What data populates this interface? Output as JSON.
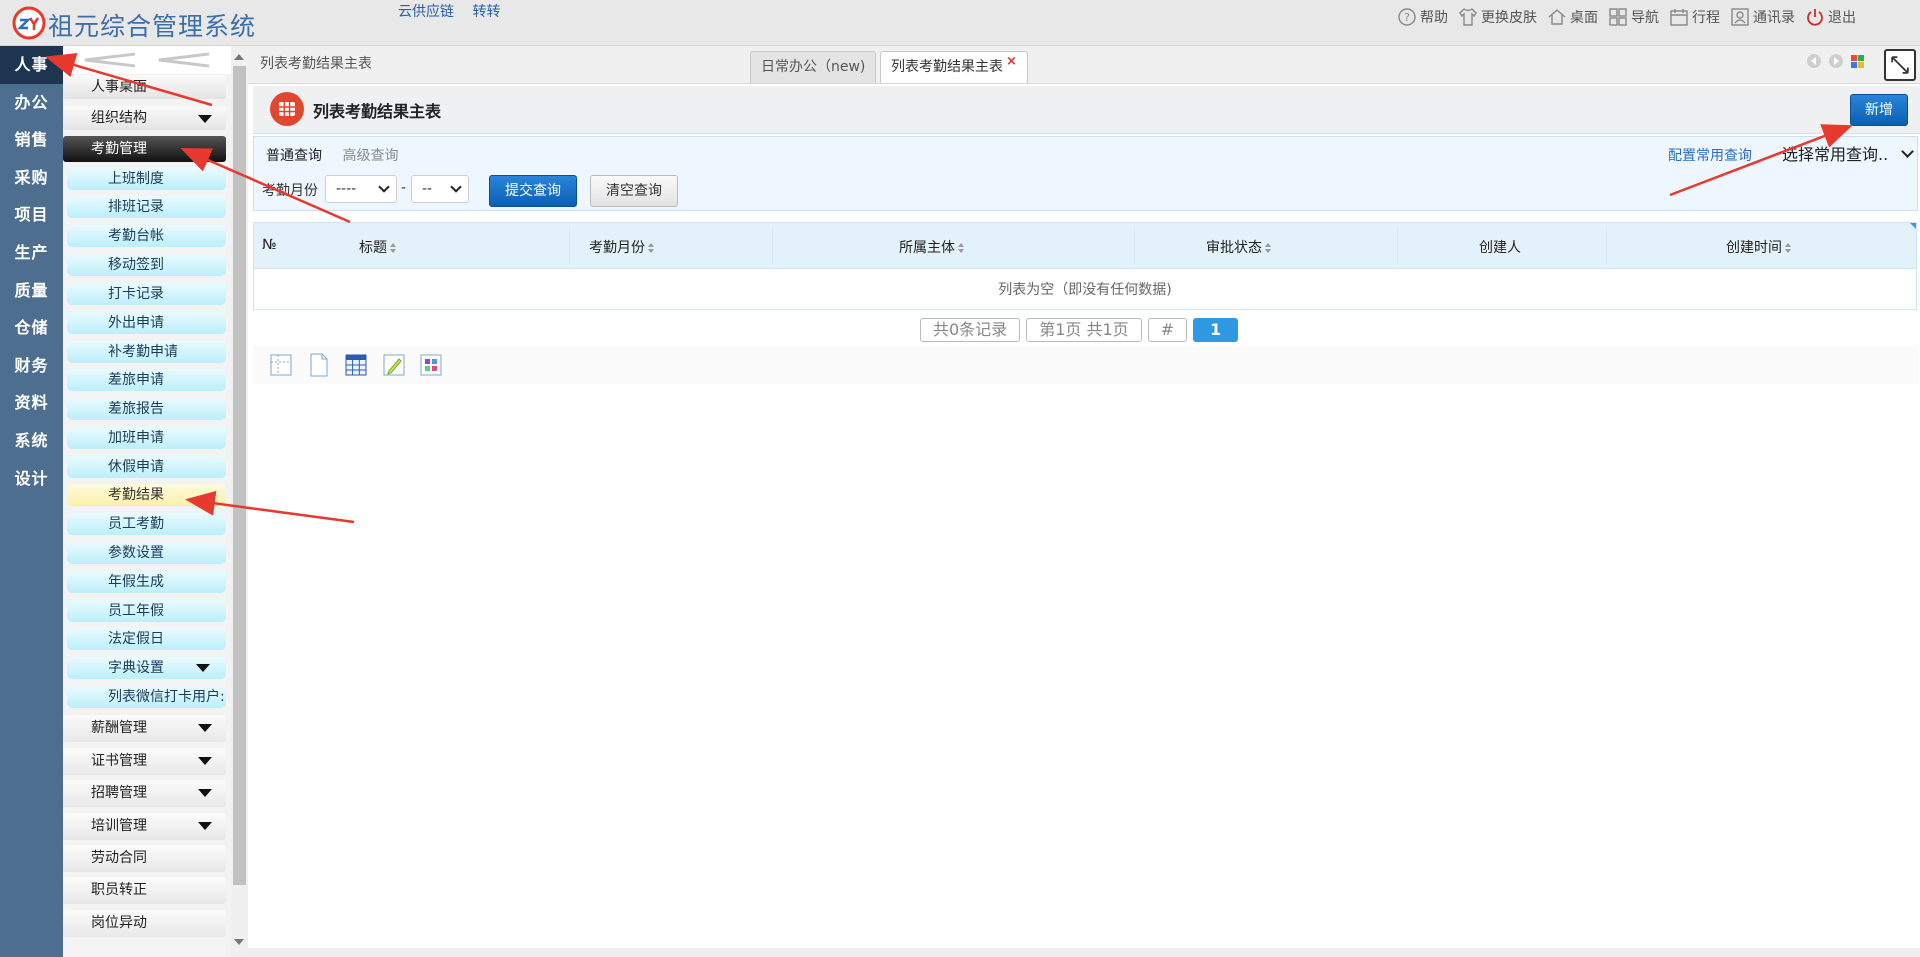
{
  "header": {
    "app_title": "祖元综合管理系统",
    "links": [
      "云供应链",
      "转转"
    ],
    "menu": [
      {
        "label": "帮助",
        "icon": "help-icon"
      },
      {
        "label": "更换皮肤",
        "icon": "shirt-icon"
      },
      {
        "label": "桌面",
        "icon": "home-icon"
      },
      {
        "label": "导航",
        "icon": "nav-grid-icon"
      },
      {
        "label": "行程",
        "icon": "calendar-icon"
      },
      {
        "label": "通讯录",
        "icon": "contacts-icon"
      },
      {
        "label": "退出",
        "icon": "power-icon"
      }
    ]
  },
  "modules": [
    "人事",
    "办公",
    "销售",
    "采购",
    "项目",
    "生产",
    "质量",
    "仓储",
    "财务",
    "资料",
    "系统",
    "设计"
  ],
  "sidebar": {
    "items": [
      {
        "label": "人事桌面",
        "type": "plain"
      },
      {
        "label": "组织结构",
        "type": "plain",
        "caret": true
      },
      {
        "label": "考勤管理",
        "type": "group-open"
      },
      {
        "label": "上班制度",
        "type": "sub"
      },
      {
        "label": "排班记录",
        "type": "sub"
      },
      {
        "label": "考勤台帐",
        "type": "sub"
      },
      {
        "label": "移动签到",
        "type": "sub"
      },
      {
        "label": "打卡记录",
        "type": "sub"
      },
      {
        "label": "外出申请",
        "type": "sub"
      },
      {
        "label": "补考勤申请",
        "type": "sub"
      },
      {
        "label": "差旅申请",
        "type": "sub"
      },
      {
        "label": "差旅报告",
        "type": "sub"
      },
      {
        "label": "加班申请",
        "type": "sub"
      },
      {
        "label": "休假申请",
        "type": "sub"
      },
      {
        "label": "考勤结果",
        "type": "sub-current"
      },
      {
        "label": "员工考勤",
        "type": "sub"
      },
      {
        "label": "参数设置",
        "type": "sub"
      },
      {
        "label": "年假生成",
        "type": "sub"
      },
      {
        "label": "员工年假",
        "type": "sub"
      },
      {
        "label": "法定假日",
        "type": "sub"
      },
      {
        "label": "字典设置",
        "type": "sub",
        "caret": true
      },
      {
        "label": "列表微信打卡用户:",
        "type": "sub"
      },
      {
        "label": "薪酬管理",
        "type": "plain",
        "caret": true
      },
      {
        "label": "证书管理",
        "type": "plain",
        "caret": true
      },
      {
        "label": "招聘管理",
        "type": "plain",
        "caret": true
      },
      {
        "label": "培训管理",
        "type": "plain",
        "caret": true
      },
      {
        "label": "劳动合同",
        "type": "plain"
      },
      {
        "label": "职员转正",
        "type": "plain"
      },
      {
        "label": "岗位异动",
        "type": "plain"
      }
    ]
  },
  "tabs": {
    "breadcrumb": "列表考勤结果主表",
    "items": [
      {
        "label": "日常办公（new)",
        "active": false
      },
      {
        "label": "列表考勤结果主表",
        "active": true,
        "close": "×"
      }
    ]
  },
  "page": {
    "title": "列表考勤结果主表",
    "add_button": "新增"
  },
  "query": {
    "tab_normal": "普通查询",
    "tab_advanced": "高级查询",
    "config_link": "配置常用查询",
    "common_select": "选择常用查询..",
    "month_label": "考勤月份",
    "year_value": "----",
    "month_value": "--",
    "range_sep": "-",
    "submit": "提交查询",
    "clear": "清空查询"
  },
  "grid": {
    "columns": [
      "№",
      "标题",
      "考勤月份",
      "所属主体",
      "审批状态",
      "创建人",
      "创建时间"
    ],
    "empty_message": "列表为空（即没有任何数据)"
  },
  "pager": {
    "total": "共0条记录",
    "page_info": "第1页 共1页",
    "jump": "#",
    "current": "1"
  },
  "colors": {
    "accent_blue": "#0b5fb5",
    "module_bg": "#4d6e8e",
    "annotation_red": "#e8392f"
  }
}
